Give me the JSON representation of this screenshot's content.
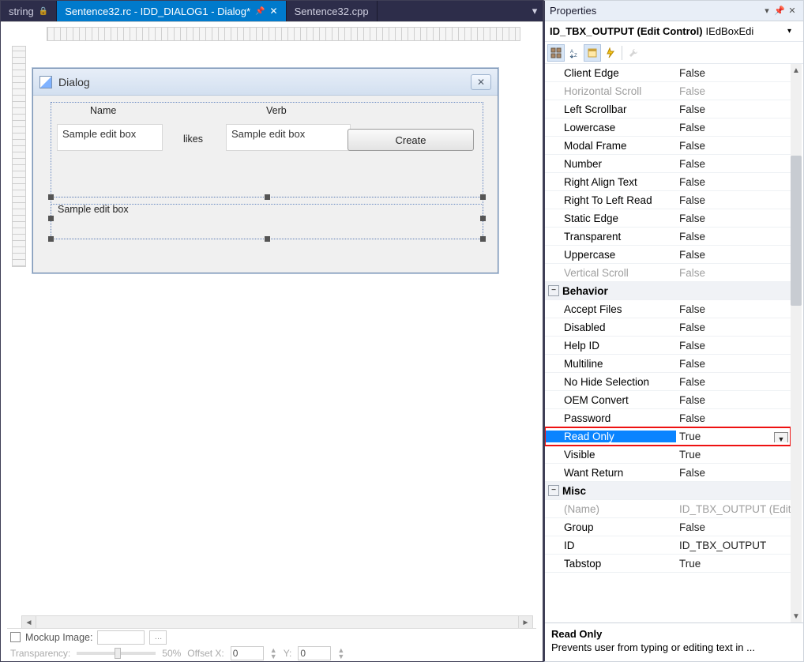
{
  "tabs": {
    "left": {
      "label": "string"
    },
    "active": {
      "label": "Sentence32.rc - IDD_DIALOG1 - Dialog*"
    },
    "right": {
      "label": "Sentence32.cpp"
    }
  },
  "dialog": {
    "title": "Dialog",
    "name_label": "Name",
    "verb_label": "Verb",
    "likes_label": "likes",
    "editbox1": "Sample edit box",
    "editbox2": "Sample edit box",
    "output_box": "Sample edit box",
    "create_btn": "Create"
  },
  "bottom": {
    "mockup_label": "Mockup Image:",
    "transparency_label": "Transparency:",
    "transparency_value": "50%",
    "offsetx_label": "Offset X:",
    "offsetx_val": "0",
    "offsety_label": "Y:",
    "offsety_val": "0"
  },
  "properties": {
    "panel_title": "Properties",
    "object_name": "ID_TBX_OUTPUT (Edit Control)",
    "object_type": "IEdBoxEdi",
    "rows": [
      {
        "name": "Client Edge",
        "value": "False"
      },
      {
        "name": "Horizontal Scroll",
        "value": "False",
        "muted": true
      },
      {
        "name": "Left Scrollbar",
        "value": "False"
      },
      {
        "name": "Lowercase",
        "value": "False"
      },
      {
        "name": "Modal Frame",
        "value": "False"
      },
      {
        "name": "Number",
        "value": "False"
      },
      {
        "name": "Right Align Text",
        "value": "False"
      },
      {
        "name": "Right To Left Read",
        "value": "False"
      },
      {
        "name": "Static Edge",
        "value": "False"
      },
      {
        "name": "Transparent",
        "value": "False"
      },
      {
        "name": "Uppercase",
        "value": "False"
      },
      {
        "name": "Vertical Scroll",
        "value": "False",
        "muted": true
      }
    ],
    "cat_behavior": "Behavior",
    "behavior_rows": [
      {
        "name": "Accept Files",
        "value": "False"
      },
      {
        "name": "Disabled",
        "value": "False"
      },
      {
        "name": "Help ID",
        "value": "False"
      },
      {
        "name": "Multiline",
        "value": "False"
      },
      {
        "name": "No Hide Selection",
        "value": "False"
      },
      {
        "name": "OEM Convert",
        "value": "False"
      },
      {
        "name": "Password",
        "value": "False"
      },
      {
        "name": "Read Only",
        "value": "True",
        "selected": true
      },
      {
        "name": "Visible",
        "value": "True"
      },
      {
        "name": "Want Return",
        "value": "False"
      }
    ],
    "cat_misc": "Misc",
    "misc_rows": [
      {
        "name": "(Name)",
        "value": "ID_TBX_OUTPUT (Edit",
        "muted": true
      },
      {
        "name": "Group",
        "value": "False"
      },
      {
        "name": "ID",
        "value": "ID_TBX_OUTPUT"
      },
      {
        "name": "Tabstop",
        "value": "True"
      }
    ],
    "desc_title": "Read Only",
    "desc_text": "Prevents user from typing or editing text in ..."
  }
}
